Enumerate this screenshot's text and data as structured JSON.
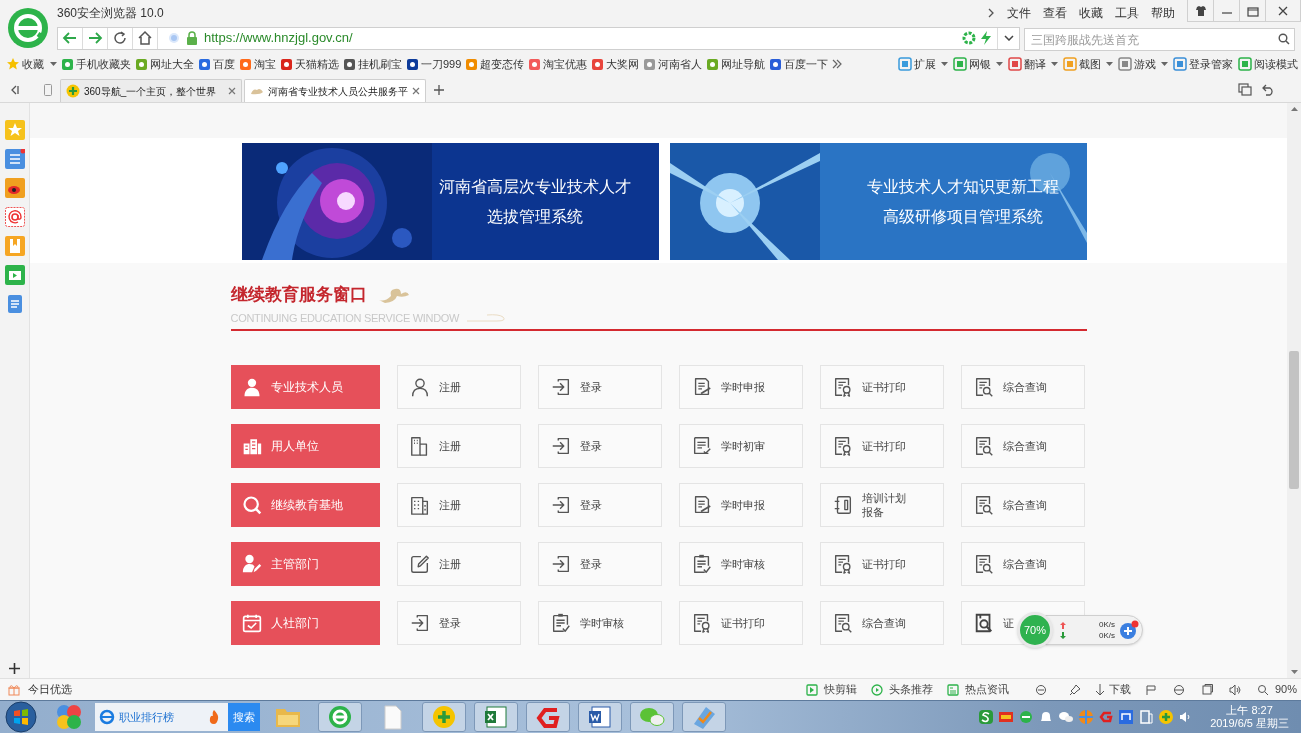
{
  "window": {
    "title": "360安全浏览器 10.0"
  },
  "menu": [
    "文件",
    "查看",
    "收藏",
    "工具",
    "帮助"
  ],
  "address_bar": {
    "url": "https://www.hnzjgl.gov.cn/"
  },
  "search": {
    "placeholder": "三国跨服战先送首充"
  },
  "bookmarks": [
    {
      "label": "收藏",
      "dropdown": true
    },
    {
      "label": "手机收藏夹",
      "dropdown": false
    },
    {
      "label": "网址大全",
      "dropdown": false
    },
    {
      "label": "百度",
      "dropdown": false
    },
    {
      "label": "淘宝",
      "dropdown": false
    },
    {
      "label": "天猫精选",
      "dropdown": false
    },
    {
      "label": "挂机刷宝",
      "dropdown": false
    },
    {
      "label": "一刀999",
      "dropdown": false
    },
    {
      "label": "超变态传",
      "dropdown": false
    },
    {
      "label": "淘宝优惠",
      "dropdown": false
    },
    {
      "label": "大奖网",
      "dropdown": false
    },
    {
      "label": "河南省人",
      "dropdown": false
    },
    {
      "label": "网址导航",
      "dropdown": false
    },
    {
      "label": "百度一下",
      "dropdown": false
    }
  ],
  "tools": [
    {
      "label": "扩展",
      "dropdown": true
    },
    {
      "label": "网银",
      "dropdown": true
    },
    {
      "label": "翻译",
      "dropdown": true
    },
    {
      "label": "截图",
      "dropdown": true
    },
    {
      "label": "游戏",
      "dropdown": true
    },
    {
      "label": "登录管家",
      "dropdown": false
    },
    {
      "label": "阅读模式",
      "dropdown": false
    }
  ],
  "tabs": [
    {
      "label": "360导航_一个主页，整个世界",
      "selected": false
    },
    {
      "label": "河南省专业技术人员公共服务平",
      "selected": true
    }
  ],
  "banners": [
    {
      "kind": "brain",
      "lines": [
        "河南省高层次专业技术人才",
        "选拔管理系统"
      ]
    },
    {
      "kind": "neuron",
      "lines": [
        "专业技术人才知识更新工程",
        "高级研修项目管理系统"
      ]
    }
  ],
  "section": {
    "title": "继续教育服务窗口",
    "subtitle": "CONTINUING EDUCATION SERVICE WINDOW"
  },
  "rows": [
    {
      "category": "专业技术人员",
      "kind": "person",
      "actions": [
        {
          "label": "注册",
          "kind": "person"
        },
        {
          "label": "登录",
          "kind": "login"
        },
        {
          "label": "学时申报",
          "kind": "report"
        },
        {
          "label": "证书打印",
          "kind": "certificate"
        },
        {
          "label": "综合查询",
          "kind": "query"
        }
      ]
    },
    {
      "category": "用人单位",
      "kind": "building",
      "actions": [
        {
          "label": "注册",
          "kind": "building"
        },
        {
          "label": "登录",
          "kind": "login"
        },
        {
          "label": "学时初审",
          "kind": "review"
        },
        {
          "label": "证书打印",
          "kind": "certificate"
        },
        {
          "label": "综合查询",
          "kind": "query"
        }
      ]
    },
    {
      "category": "继续教育基地",
      "kind": "search",
      "actions": [
        {
          "label": "注册",
          "kind": "tower"
        },
        {
          "label": "登录",
          "kind": "login"
        },
        {
          "label": "学时申报",
          "kind": "report"
        },
        {
          "label": "培训计划报备",
          "kind": "plan"
        },
        {
          "label": "综合查询",
          "kind": "query"
        }
      ]
    },
    {
      "category": "主管部门",
      "kind": "manager",
      "actions": [
        {
          "label": "注册",
          "kind": "edit"
        },
        {
          "label": "登录",
          "kind": "login"
        },
        {
          "label": "学时审核",
          "kind": "audit"
        },
        {
          "label": "证书打印",
          "kind": "certificate"
        },
        {
          "label": "综合查询",
          "kind": "query"
        }
      ]
    },
    {
      "category": "人社部门",
      "kind": "calendar",
      "actions": [
        {
          "label": "登录",
          "kind": "login"
        },
        {
          "label": "学时审核",
          "kind": "audit"
        },
        {
          "label": "证书打印",
          "kind": "certificate"
        },
        {
          "label": "综合查询",
          "kind": "query"
        },
        {
          "label": "证",
          "kind": "lookup"
        }
      ]
    }
  ],
  "speed_widget": {
    "percent": "70%",
    "upload": "0K/s",
    "download": "0K/s"
  },
  "status_bar": {
    "left": "今日优选",
    "items": [
      "快剪辑",
      "头条推荐",
      "热点资讯"
    ],
    "download": "下载",
    "zoom": "90%"
  },
  "taskbar": {
    "search_text": "职业排行榜",
    "search_button": "搜索",
    "time": "上午 8:27",
    "date": "2019/6/5 星期三"
  }
}
